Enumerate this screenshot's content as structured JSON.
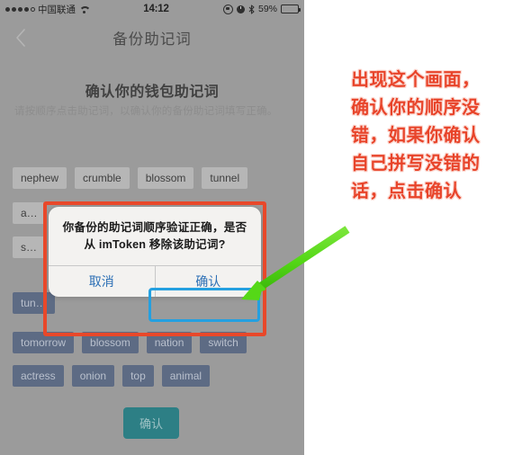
{
  "status_bar": {
    "carrier": "中国联通",
    "signal_dots_filled": 4,
    "signal_dots_hollow": 1,
    "wifi_icon": "wifi-icon",
    "time": "14:12",
    "rotation_lock_icon": "rotation-lock-icon",
    "alarm_icon": "alarm-clock-icon",
    "bluetooth_icon": "bluetooth-icon",
    "battery_percent": "59%",
    "battery_fill_pct": 59
  },
  "nav": {
    "back_icon": "chevron-left-icon",
    "title": "备份助记词"
  },
  "page": {
    "heading": "确认你的钱包助记词",
    "subheading": "请按顺序点击助记词，以确认你的备份助记词填写正确。",
    "bottom_button": "确认"
  },
  "chips": {
    "pool_row_1": [
      "nephew",
      "crumble",
      "blossom",
      "tunnel"
    ],
    "pool_row_2_partial": [
      "a…"
    ],
    "pool_row_3_partial": [
      "s…"
    ],
    "selected_row_1_partial": [
      "tun…"
    ],
    "selected_row_2": [
      "tomorrow",
      "blossom",
      "nation",
      "switch"
    ],
    "selected_row_3": [
      "actress",
      "onion",
      "top",
      "animal"
    ]
  },
  "dialog": {
    "message": "你备份的助记词顺序验证正确，是否从 imToken 移除该助记词?",
    "cancel_label": "取消",
    "confirm_label": "确认"
  },
  "annotation": {
    "text": "出现这个画面，确认你的顺序没错，如果你确认自己拼写没错的话，点击确认",
    "arrow_icon": "green-arrow-icon",
    "highlight_icon": "blue-highlight-box",
    "callout_icon": "red-callout-box"
  },
  "colors": {
    "annotation_red": "#e8442a",
    "highlight_blue": "#24a0e0",
    "arrow_green": "#55d817",
    "dialog_link_blue": "#2c6fb5",
    "confirm_teal": "#2d7f85",
    "selected_chip": "#5d6b84"
  }
}
